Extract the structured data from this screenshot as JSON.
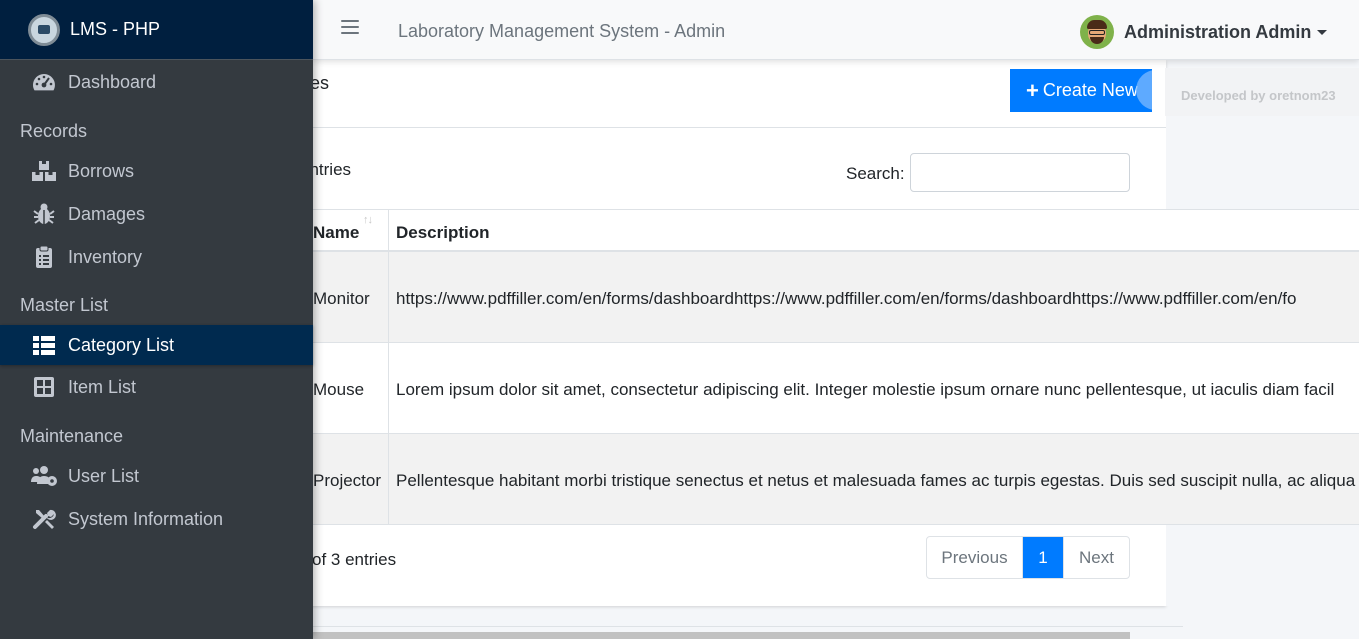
{
  "app": {
    "brand": "LMS - PHP",
    "nav_title": "Laboratory Management System - Admin",
    "user_name": "Administration Admin",
    "credit": "Developed by oretnom23"
  },
  "sidebar": {
    "dashboard": "Dashboard",
    "records_header": "Records",
    "borrows": "Borrows",
    "damages": "Damages",
    "inventory": "Inventory",
    "master_header": "Master List",
    "category_list": "Category List",
    "item_list": "Item List",
    "maintenance_header": "Maintenance",
    "user_list": "User List",
    "system_information": "System Information"
  },
  "card": {
    "title": "es",
    "create_label": "Create New",
    "entries_text": "entries",
    "search_label": "Search:",
    "search_value": "",
    "info_text": "of 3 entries"
  },
  "table": {
    "headers": {
      "name": "Name",
      "description": "Description"
    },
    "rows": [
      {
        "name": "Monitor",
        "description": "https://www.pdffiller.com/en/forms/dashboardhttps://www.pdffiller.com/en/forms/dashboardhttps://www.pdffiller.com/en/fo"
      },
      {
        "name": "Mouse",
        "description": "Lorem ipsum dolor sit amet, consectetur adipiscing elit. Integer molestie ipsum ornare nunc pellentesque, ut iaculis diam facil"
      },
      {
        "name": "Projector",
        "description": "Pellentesque habitant morbi tristique senectus et netus et malesuada fames ac turpis egestas. Duis sed suscipit nulla, ac aliqua"
      }
    ]
  },
  "pagination": {
    "previous": "Previous",
    "current": "1",
    "next": "Next"
  },
  "colors": {
    "primary": "#007bff",
    "sidebar_bg": "#343a40",
    "brand_bg": "#001f3f",
    "active_bg": "#002a4f"
  }
}
